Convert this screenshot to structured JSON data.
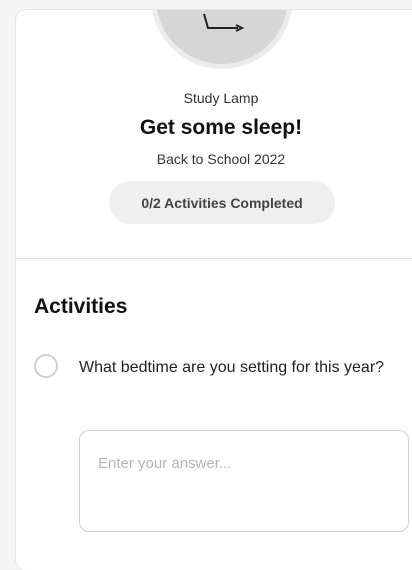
{
  "header": {
    "subtitle": "Study Lamp",
    "title": "Get some sleep!",
    "campaign": "Back to School 2022",
    "progress": "0/2 Activities Completed"
  },
  "activities": {
    "heading": "Activities",
    "items": [
      {
        "question": "What bedtime are you setting for this year?",
        "completed": false,
        "answer_placeholder": "Enter your answer..."
      }
    ]
  },
  "icons": {
    "avatar": "lamp-icon",
    "check": "radio-circle-icon"
  },
  "colors": {
    "background": "#ffffff",
    "pill": "#efefef",
    "border": "#cfcfcf"
  }
}
